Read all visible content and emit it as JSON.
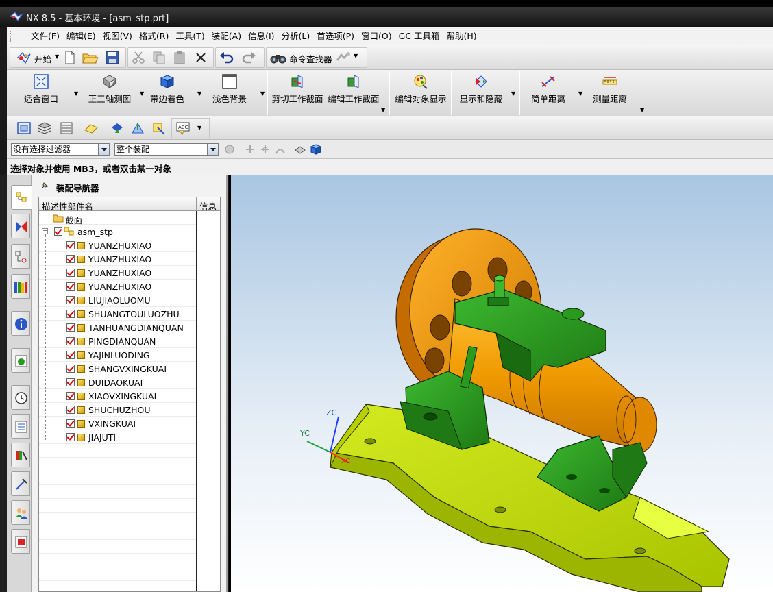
{
  "window": {
    "title": "NX 8.5 - 基本环境 - [asm_stp.prt]"
  },
  "menu": {
    "items": [
      "文件(F)",
      "编辑(E)",
      "视图(V)",
      "格式(R)",
      "工具(T)",
      "装配(A)",
      "信息(I)",
      "分析(L)",
      "首选项(P)",
      "窗口(O)",
      "GC 工具箱",
      "帮助(H)"
    ]
  },
  "toolbar_standard": {
    "start_label": "开始",
    "command_finder_label": "命令查找器"
  },
  "toolbar_view": {
    "buttons": [
      "适合窗口",
      "正三轴测图",
      "带边着色",
      "浅色背景",
      "剪切工作截面",
      "编辑工作截面",
      "编辑对象显示",
      "显示和隐藏",
      "简单距离",
      "测量距离"
    ]
  },
  "selection_bar": {
    "type_filter": "没有选择过滤器",
    "scope": "整个装配"
  },
  "cue_line": {
    "text": "选择对象并使用 MB3，或者双击某一对象"
  },
  "assembly_navigator": {
    "title": "装配导航器",
    "columns": [
      "描述性部件名",
      "信息"
    ],
    "section_node": "截面",
    "root": "asm_stp",
    "components": [
      "YUANZHUXIAO",
      "YUANZHUXIAO",
      "YUANZHUXIAO",
      "YUANZHUXIAO",
      "LIUJIAOLUOMU",
      "SHUANGTOULUOZHU",
      "TANHUANGDIANQUAN",
      "PINGDIANQUAN",
      "YAJINLUODING",
      "SHANGVXINGKUAI",
      "DUIDAOKUAI",
      "XIAOVXINGKUAI",
      "SHUCHUZHOU",
      "VXINGKUAI",
      "JIAJUTI"
    ]
  },
  "viewport": {
    "triad": {
      "z_label": "ZC",
      "y_label": "YC",
      "x_label": "XC"
    },
    "colors": {
      "base": "#c6e000",
      "blocks": "#2a9a1e",
      "shaft": "#f0a000",
      "background_top": "#a9c6e2"
    }
  }
}
